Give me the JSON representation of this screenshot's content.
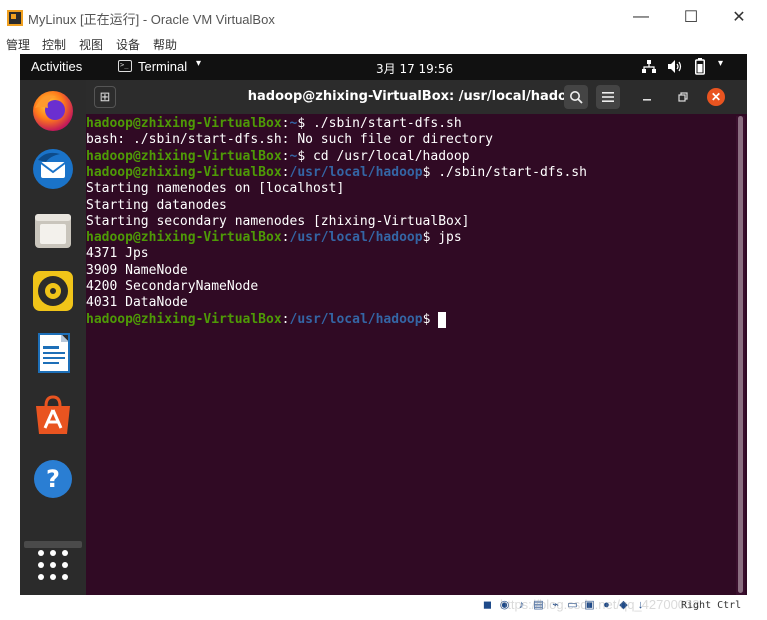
{
  "host_window": {
    "title": "MyLinux [正在运行] - Oracle VM VirtualBox",
    "menus": [
      "管理",
      "控制",
      "视图",
      "设备",
      "帮助"
    ],
    "controls": {
      "minimize": "—",
      "maximize": "☐",
      "close": "✕"
    }
  },
  "topbar": {
    "activities": "Activities",
    "app": "Terminal",
    "app_caret": "▾",
    "clock": "3月 17  19:56",
    "tray_icons": [
      "network-icon",
      "volume-icon",
      "battery-icon",
      "menu-caret-icon"
    ]
  },
  "dock": {
    "apps": [
      "firefox-icon",
      "thunderbird-icon",
      "files-icon",
      "rhythmbox-icon",
      "libreoffice-writer-icon",
      "software-center-icon",
      "help-icon"
    ],
    "show_apps": "show-applications-icon"
  },
  "terminal": {
    "title": "hadoop@zhixing-VirtualBox: /usr/local/hadoop",
    "user_host": "hadoop@zhixing-VirtualBox",
    "lines": [
      {
        "type": "prompt",
        "path": "~",
        "symbol": "$",
        "cmd": " ./sbin/start-dfs.sh"
      },
      {
        "type": "output",
        "text": "bash: ./sbin/start-dfs.sh: No such file or directory"
      },
      {
        "type": "prompt",
        "path": "~",
        "symbol": "$",
        "cmd": " cd /usr/local/hadoop"
      },
      {
        "type": "prompt",
        "path": "/usr/local/hadoop",
        "symbol": "$",
        "cmd": " ./sbin/start-dfs.sh"
      },
      {
        "type": "output",
        "text": "Starting namenodes on [localhost]"
      },
      {
        "type": "output",
        "text": "Starting datanodes"
      },
      {
        "type": "output",
        "text": "Starting secondary namenodes [zhixing-VirtualBox]"
      },
      {
        "type": "prompt",
        "path": "/usr/local/hadoop",
        "symbol": "$",
        "cmd": " jps"
      },
      {
        "type": "output",
        "text": "4371 Jps"
      },
      {
        "type": "output",
        "text": "3909 NameNode"
      },
      {
        "type": "output",
        "text": "4200 SecondaryNameNode"
      },
      {
        "type": "output",
        "text": "4031 DataNode"
      },
      {
        "type": "prompt_cursor",
        "path": "/usr/local/hadoop",
        "symbol": "$",
        "cmd": " "
      }
    ]
  },
  "statusbar": {
    "host_key": "Right Ctrl",
    "watermark": "https://blog.csdn.net/qq_42700033"
  },
  "colors": {
    "terminal_bg": "#300a24",
    "prompt_user": "#4e9a06",
    "prompt_path": "#3465a4",
    "close_button": "#e95420"
  }
}
